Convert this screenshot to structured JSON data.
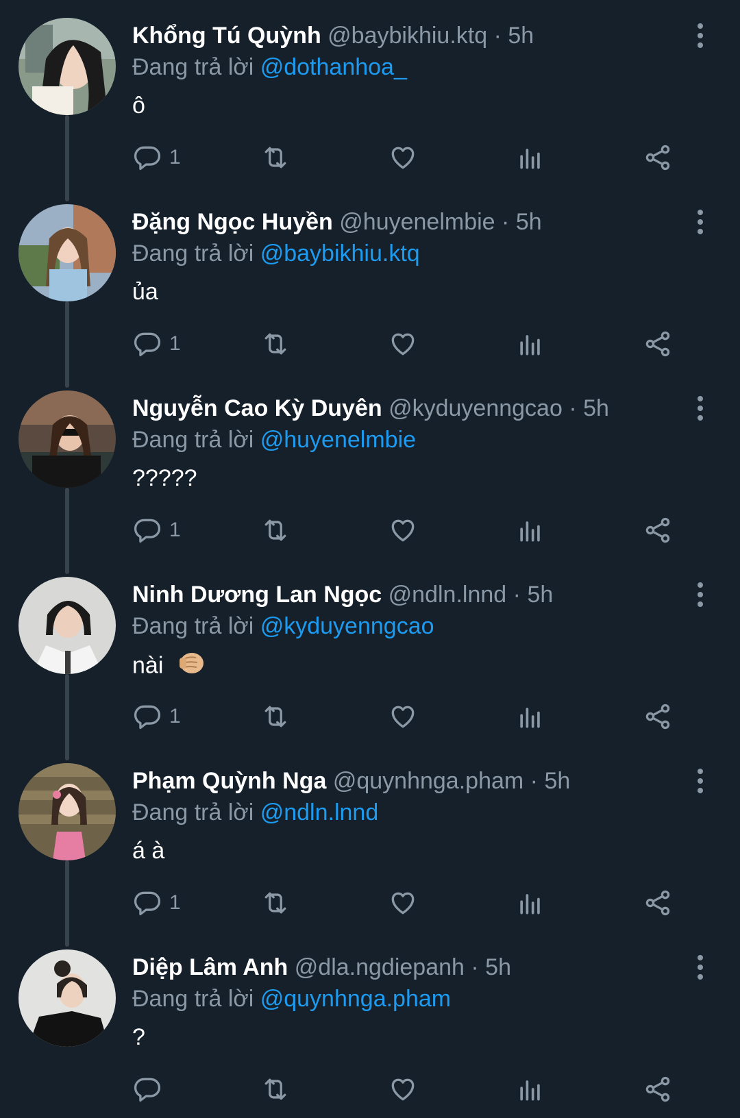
{
  "colors": {
    "background": "#15202b",
    "text_primary": "#ffffff",
    "text_secondary": "#8b98a5",
    "mention": "#1d9bf0",
    "thread_line": "#38444d"
  },
  "tweets": [
    {
      "display_name": "Khổng Tú Quỳnh",
      "handle": "@baybikhiu.ktq",
      "separator": "·",
      "time": "5h",
      "replying_prefix": "Đang trả lời",
      "replying_to": "@dothanhoa_",
      "text": "ô",
      "reply_count": "1",
      "icons": [
        "reply-icon",
        "retweet-icon",
        "like-icon",
        "views-icon",
        "share-icon",
        "more-icon"
      ]
    },
    {
      "display_name": "Đặng Ngọc Huyền",
      "handle": "@huyenelmbie",
      "separator": "·",
      "time": "5h",
      "replying_prefix": "Đang trả lời",
      "replying_to": "@baybikhiu.ktq",
      "text": "ủa",
      "reply_count": "1",
      "icons": [
        "reply-icon",
        "retweet-icon",
        "like-icon",
        "views-icon",
        "share-icon",
        "more-icon"
      ]
    },
    {
      "display_name": "Nguyễn Cao Kỳ Duyên",
      "handle": "@kyduyenngcao",
      "separator": "·",
      "time": "5h",
      "replying_prefix": "Đang trả lời",
      "replying_to": "@huyenelmbie",
      "text": "?????",
      "reply_count": "1",
      "icons": [
        "reply-icon",
        "retweet-icon",
        "like-icon",
        "views-icon",
        "share-icon",
        "more-icon"
      ]
    },
    {
      "display_name": "Ninh Dương Lan Ngọc",
      "handle": "@ndln.lnnd",
      "separator": "·",
      "time": "5h",
      "replying_prefix": "Đang trả lời",
      "replying_to": "@kyduyenngcao",
      "text": "nài",
      "emoji": "fist-bump-emoji",
      "reply_count": "1",
      "icons": [
        "reply-icon",
        "retweet-icon",
        "like-icon",
        "views-icon",
        "share-icon",
        "more-icon"
      ]
    },
    {
      "display_name": "Phạm Quỳnh Nga",
      "handle": "@quynhnga.pham",
      "separator": "·",
      "time": "5h",
      "replying_prefix": "Đang trả lời",
      "replying_to": "@ndln.lnnd",
      "text": "á à",
      "reply_count": "1",
      "icons": [
        "reply-icon",
        "retweet-icon",
        "like-icon",
        "views-icon",
        "share-icon",
        "more-icon"
      ]
    },
    {
      "display_name": "Diệp Lâm Anh",
      "handle": "@dla.ngdiepanh",
      "separator": "·",
      "time": "5h",
      "replying_prefix": "Đang trả lời",
      "replying_to": "@quynhnga.pham",
      "text": "?",
      "reply_count": "",
      "icons": [
        "reply-icon",
        "retweet-icon",
        "like-icon",
        "views-icon",
        "share-icon",
        "more-icon"
      ]
    }
  ]
}
